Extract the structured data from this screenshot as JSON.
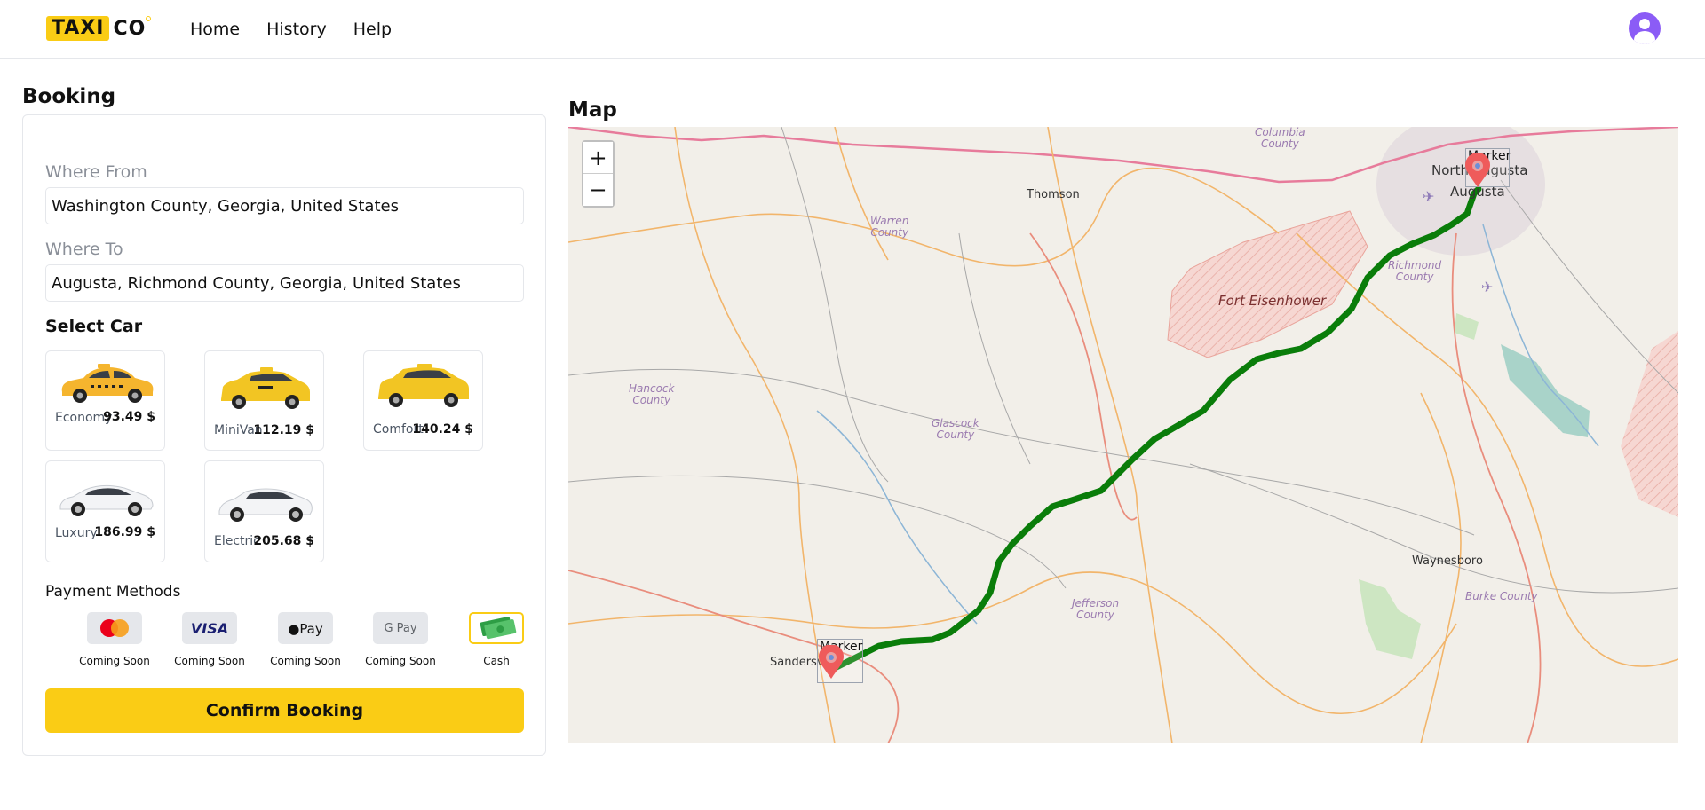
{
  "header": {
    "logo_taxi": "TAXI",
    "logo_co": "CO",
    "nav": [
      "Home",
      "History",
      "Help"
    ]
  },
  "booking": {
    "title": "Booking",
    "from_label": "Where From",
    "from_value": "Washington County, Georgia, United States",
    "to_label": "Where To",
    "to_value": "Augusta, Richmond County, Georgia, United States",
    "select_car_label": "Select Car",
    "cars": [
      {
        "name": "Economy",
        "price": "93.49 $"
      },
      {
        "name": "MiniVan",
        "price": "112.19 $"
      },
      {
        "name": "Comfort",
        "price": "140.24 $"
      },
      {
        "name": "Luxury",
        "price": "186.99 $"
      },
      {
        "name": "Electric",
        "price": "205.68 $"
      }
    ],
    "payment_label": "Payment Methods",
    "payments": [
      {
        "icon": "mastercard-icon",
        "caption": "Coming Soon"
      },
      {
        "icon": "visa-icon",
        "text": "VISA",
        "caption": "Coming Soon"
      },
      {
        "icon": "apple-pay-icon",
        "text": "Pay",
        "caption": "Coming Soon"
      },
      {
        "icon": "google-pay-icon",
        "text": "G Pay",
        "caption": "Coming Soon"
      },
      {
        "icon": "cash-icon",
        "caption": "Cash"
      }
    ],
    "selected_payment": "Cash",
    "confirm_label": "Confirm Booking"
  },
  "map": {
    "title": "Map",
    "zoom_in": "+",
    "zoom_out": "−",
    "marker_label": "Marker",
    "labels": {
      "thomson": "Thomson",
      "warren": "Warren\nCounty",
      "columbia": "Columbia\nCounty",
      "north_augusta": "North Augusta",
      "augusta": "Augusta",
      "richmond": "Richmond\nCounty",
      "fort": "Fort Eisenhower",
      "hancock": "Hancock\nCounty",
      "glascock": "Glascock\nCounty",
      "jefferson": "Jefferson\nCounty",
      "waynesboro": "Waynesboro",
      "burke": "Burke County",
      "sandersville": "Sandersv"
    },
    "route_color": "#0a7d0a"
  },
  "colors": {
    "accent": "#facc15",
    "avatar": "#8b5cf6"
  }
}
